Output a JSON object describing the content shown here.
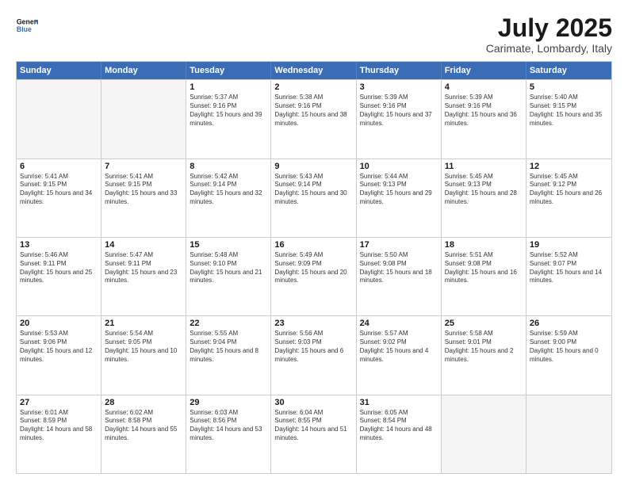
{
  "header": {
    "logo_line1": "General",
    "logo_line2": "Blue",
    "month_title": "July 2025",
    "location": "Carimate, Lombardy, Italy"
  },
  "days_of_week": [
    "Sunday",
    "Monday",
    "Tuesday",
    "Wednesday",
    "Thursday",
    "Friday",
    "Saturday"
  ],
  "rows": [
    [
      {
        "day": "",
        "text": "",
        "empty": true
      },
      {
        "day": "",
        "text": "",
        "empty": true
      },
      {
        "day": "1",
        "text": "Sunrise: 5:37 AM\nSunset: 9:16 PM\nDaylight: 15 hours and 39 minutes."
      },
      {
        "day": "2",
        "text": "Sunrise: 5:38 AM\nSunset: 9:16 PM\nDaylight: 15 hours and 38 minutes."
      },
      {
        "day": "3",
        "text": "Sunrise: 5:39 AM\nSunset: 9:16 PM\nDaylight: 15 hours and 37 minutes."
      },
      {
        "day": "4",
        "text": "Sunrise: 5:39 AM\nSunset: 9:16 PM\nDaylight: 15 hours and 36 minutes."
      },
      {
        "day": "5",
        "text": "Sunrise: 5:40 AM\nSunset: 9:15 PM\nDaylight: 15 hours and 35 minutes."
      }
    ],
    [
      {
        "day": "6",
        "text": "Sunrise: 5:41 AM\nSunset: 9:15 PM\nDaylight: 15 hours and 34 minutes."
      },
      {
        "day": "7",
        "text": "Sunrise: 5:41 AM\nSunset: 9:15 PM\nDaylight: 15 hours and 33 minutes."
      },
      {
        "day": "8",
        "text": "Sunrise: 5:42 AM\nSunset: 9:14 PM\nDaylight: 15 hours and 32 minutes."
      },
      {
        "day": "9",
        "text": "Sunrise: 5:43 AM\nSunset: 9:14 PM\nDaylight: 15 hours and 30 minutes."
      },
      {
        "day": "10",
        "text": "Sunrise: 5:44 AM\nSunset: 9:13 PM\nDaylight: 15 hours and 29 minutes."
      },
      {
        "day": "11",
        "text": "Sunrise: 5:45 AM\nSunset: 9:13 PM\nDaylight: 15 hours and 28 minutes."
      },
      {
        "day": "12",
        "text": "Sunrise: 5:45 AM\nSunset: 9:12 PM\nDaylight: 15 hours and 26 minutes."
      }
    ],
    [
      {
        "day": "13",
        "text": "Sunrise: 5:46 AM\nSunset: 9:11 PM\nDaylight: 15 hours and 25 minutes."
      },
      {
        "day": "14",
        "text": "Sunrise: 5:47 AM\nSunset: 9:11 PM\nDaylight: 15 hours and 23 minutes."
      },
      {
        "day": "15",
        "text": "Sunrise: 5:48 AM\nSunset: 9:10 PM\nDaylight: 15 hours and 21 minutes."
      },
      {
        "day": "16",
        "text": "Sunrise: 5:49 AM\nSunset: 9:09 PM\nDaylight: 15 hours and 20 minutes."
      },
      {
        "day": "17",
        "text": "Sunrise: 5:50 AM\nSunset: 9:08 PM\nDaylight: 15 hours and 18 minutes."
      },
      {
        "day": "18",
        "text": "Sunrise: 5:51 AM\nSunset: 9:08 PM\nDaylight: 15 hours and 16 minutes."
      },
      {
        "day": "19",
        "text": "Sunrise: 5:52 AM\nSunset: 9:07 PM\nDaylight: 15 hours and 14 minutes."
      }
    ],
    [
      {
        "day": "20",
        "text": "Sunrise: 5:53 AM\nSunset: 9:06 PM\nDaylight: 15 hours and 12 minutes."
      },
      {
        "day": "21",
        "text": "Sunrise: 5:54 AM\nSunset: 9:05 PM\nDaylight: 15 hours and 10 minutes."
      },
      {
        "day": "22",
        "text": "Sunrise: 5:55 AM\nSunset: 9:04 PM\nDaylight: 15 hours and 8 minutes."
      },
      {
        "day": "23",
        "text": "Sunrise: 5:56 AM\nSunset: 9:03 PM\nDaylight: 15 hours and 6 minutes."
      },
      {
        "day": "24",
        "text": "Sunrise: 5:57 AM\nSunset: 9:02 PM\nDaylight: 15 hours and 4 minutes."
      },
      {
        "day": "25",
        "text": "Sunrise: 5:58 AM\nSunset: 9:01 PM\nDaylight: 15 hours and 2 minutes."
      },
      {
        "day": "26",
        "text": "Sunrise: 5:59 AM\nSunset: 9:00 PM\nDaylight: 15 hours and 0 minutes."
      }
    ],
    [
      {
        "day": "27",
        "text": "Sunrise: 6:01 AM\nSunset: 8:59 PM\nDaylight: 14 hours and 58 minutes."
      },
      {
        "day": "28",
        "text": "Sunrise: 6:02 AM\nSunset: 8:58 PM\nDaylight: 14 hours and 55 minutes."
      },
      {
        "day": "29",
        "text": "Sunrise: 6:03 AM\nSunset: 8:56 PM\nDaylight: 14 hours and 53 minutes."
      },
      {
        "day": "30",
        "text": "Sunrise: 6:04 AM\nSunset: 8:55 PM\nDaylight: 14 hours and 51 minutes."
      },
      {
        "day": "31",
        "text": "Sunrise: 6:05 AM\nSunset: 8:54 PM\nDaylight: 14 hours and 48 minutes."
      },
      {
        "day": "",
        "text": "",
        "empty": true
      },
      {
        "day": "",
        "text": "",
        "empty": true
      }
    ]
  ]
}
